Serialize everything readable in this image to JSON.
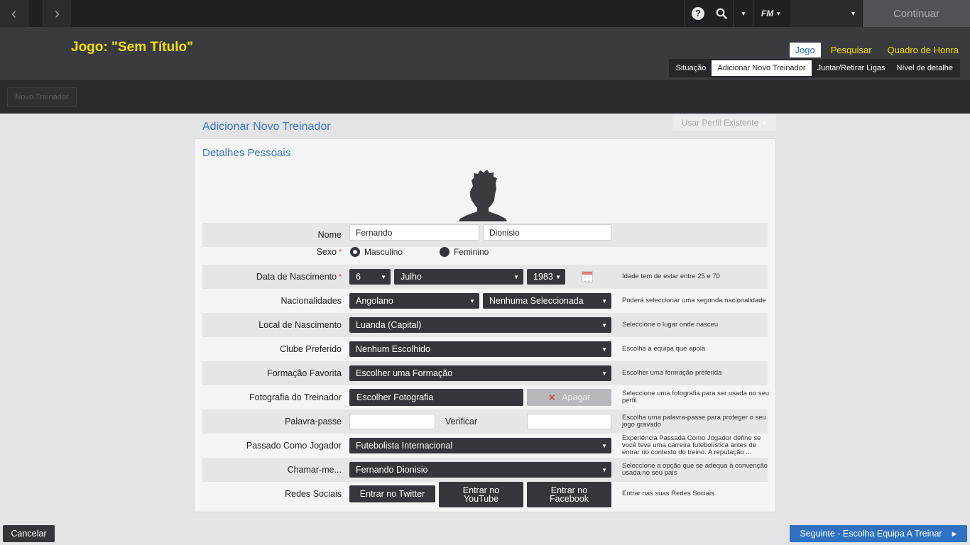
{
  "topbar": {
    "back_icon": "‹",
    "forward_icon": "›",
    "help_icon": "?",
    "search_icon": "search-icon",
    "logo": "FM",
    "continue_label": "Continuar"
  },
  "header": {
    "title": "Jogo: \"Sem Título\"",
    "tabs": [
      {
        "label": "Jogo",
        "active": true
      },
      {
        "label": "Pesquisar",
        "active": false
      },
      {
        "label": "Quadro de Honra",
        "active": false
      }
    ],
    "subtabs": [
      {
        "label": "Situação",
        "active": false
      },
      {
        "label": "Adicionar Novo Treinador",
        "active": true
      },
      {
        "label": "Juntar/Retirar Ligas",
        "active": false
      },
      {
        "label": "Nível de detalhe",
        "active": false
      }
    ]
  },
  "toolbar": {
    "new_coach_label": "Novo Treinador"
  },
  "panel": {
    "section_title": "Adicionar Novo Treinador",
    "use_profile_label": "Usar Perfil Existente",
    "details_title": "Detalhes Pessoais"
  },
  "form": {
    "name": {
      "label": "Nome",
      "first": "Fernando",
      "last": "Dionisio"
    },
    "sex": {
      "label": "Sexo",
      "required": "*",
      "male": "Masculino",
      "female": "Feminino",
      "selected": "Masculino"
    },
    "dob": {
      "label": "Data de Nascimento",
      "required": "*",
      "day": "6",
      "month": "Julho",
      "year": "1983",
      "hint": "Idade tem de estar entre 25 e 70"
    },
    "nationality": {
      "label": "Nacionalidades",
      "primary": "Angolano",
      "secondary": "Nenhuma Seleccionada",
      "hint": "Poderá seleccionar uma segunda nacionalidade"
    },
    "birthplace": {
      "label": "Local de Nascimento",
      "value": "Luanda (Capital)",
      "hint": "Seleccione o lugar onde nasceu"
    },
    "club": {
      "label": "Clube Preferido",
      "value": "Nenhum Escolhido",
      "hint": "Escolha a equipa que apoia"
    },
    "formation": {
      "label": "Formação Favorita",
      "value": "Escolher uma Formação",
      "hint": "Escolher uma formação preferida"
    },
    "photo": {
      "label": "Fotografia do Treinador",
      "choose": "Escolher Fotografia",
      "delete": "Apagar",
      "hint": "Seleccione uma fotografia para ser usada no seu perfil"
    },
    "password": {
      "label": "Palavra-passe",
      "verify_label": "Verificar",
      "hint": "Escolha uma palavra-passe para proteger o seu jogo gravado"
    },
    "past": {
      "label": "Passado Como Jogador",
      "value": "Futebolista Internacional",
      "hint": "Experiência Passada Como Jogador define se você teve uma carreira futebolística antes de entrar no contexto do treino. A reputação ..."
    },
    "call": {
      "label": "Chamar-me...",
      "value": "Fernando Dionisio",
      "hint": "Seleccione a opção que se adequa à convenção usada no seu país"
    },
    "social": {
      "label": "Redes Sociais",
      "twitter": "Entrar no Twitter",
      "youtube": "Entrar no YouTube",
      "facebook": "Entrar no Facebook",
      "hint": "Entrar nas suas Redes Sociais"
    }
  },
  "footer": {
    "cancel_label": "Cancelar",
    "next_label": "Seguinte - Escolha Equipa A Treinar"
  }
}
